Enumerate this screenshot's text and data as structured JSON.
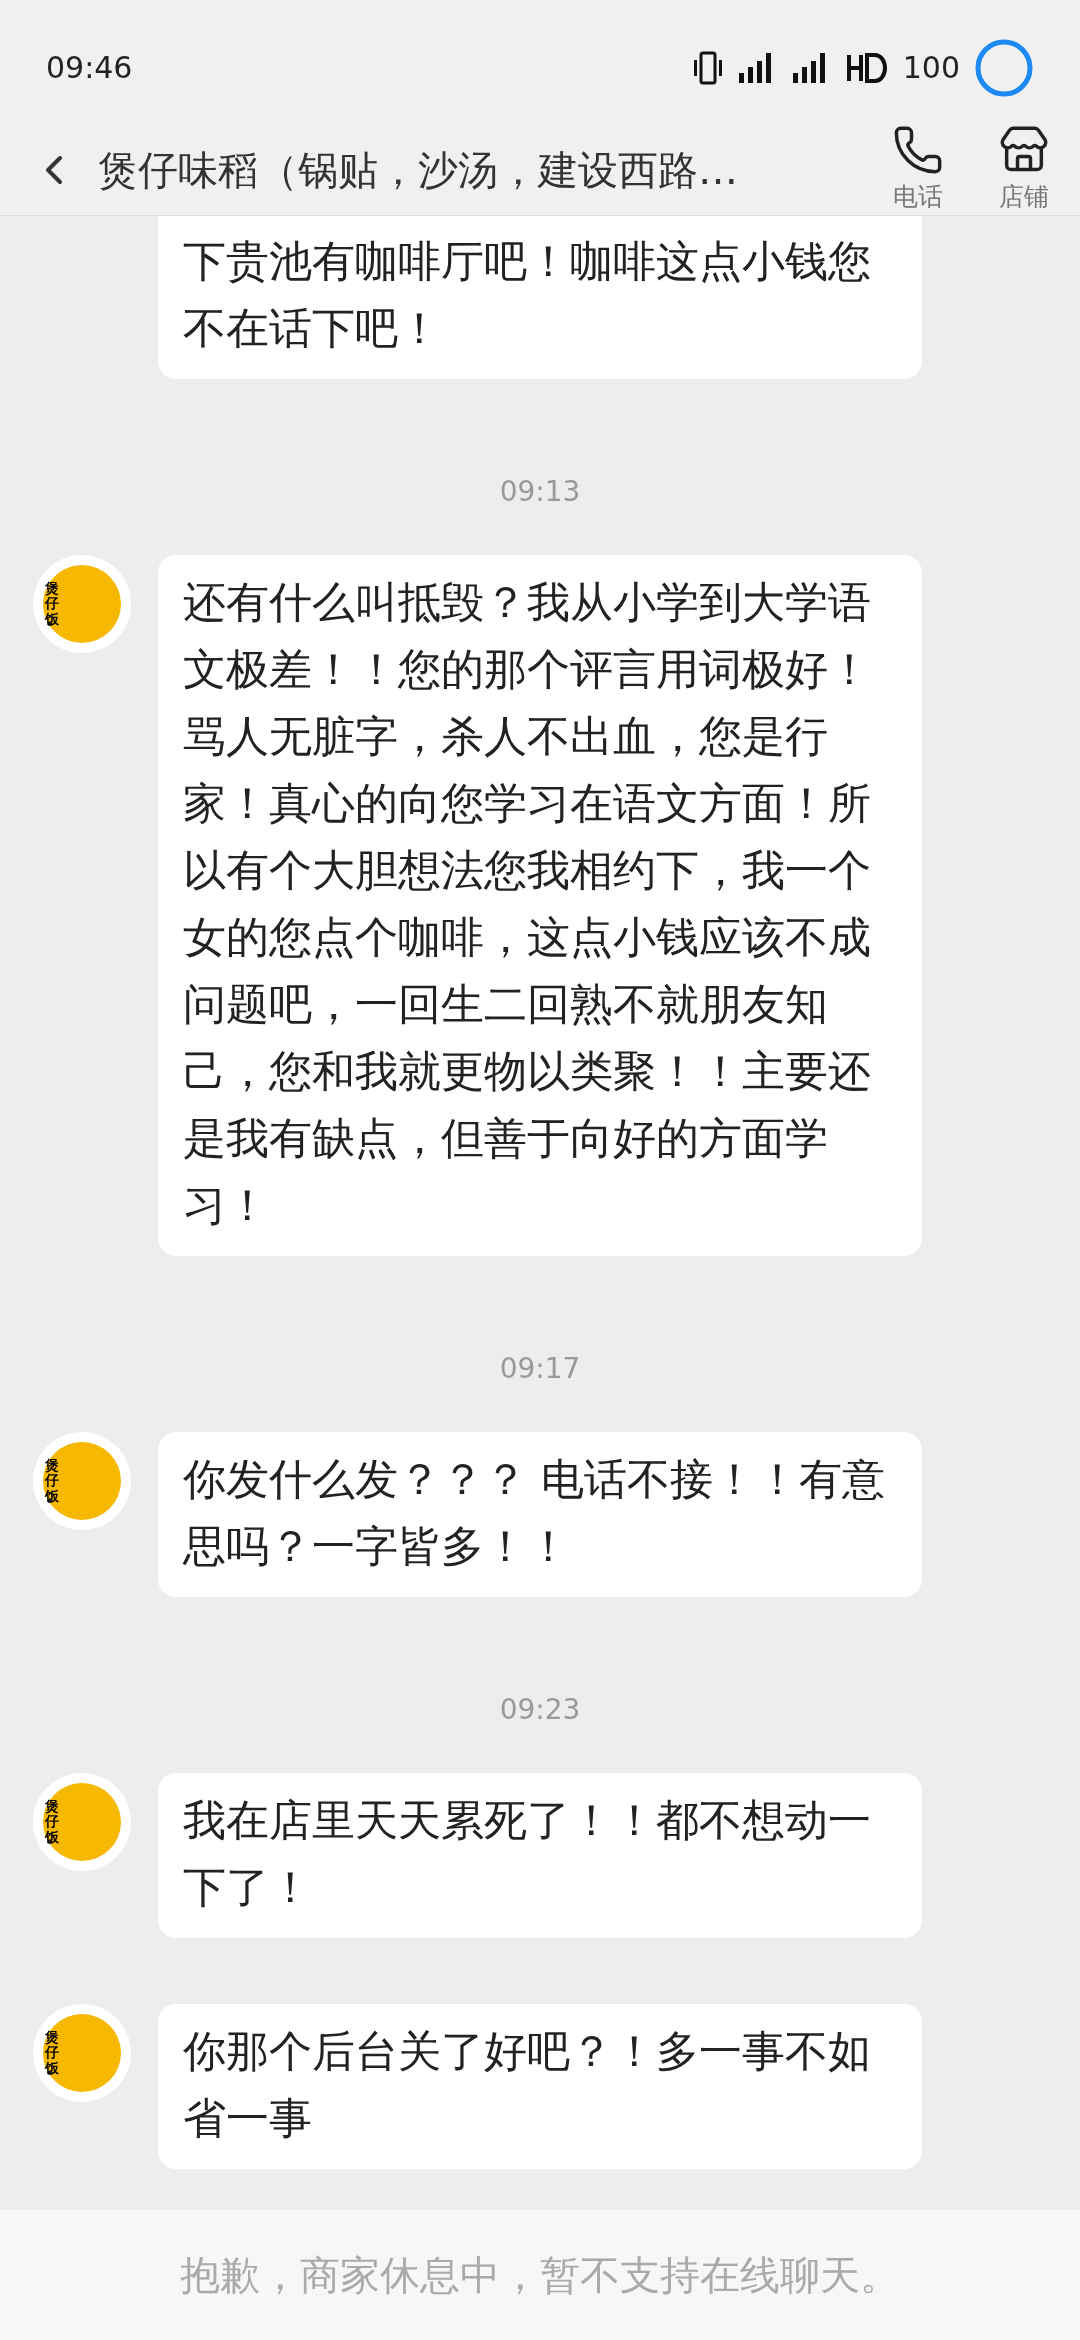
{
  "status_bar": {
    "time": "09:46",
    "battery": "100"
  },
  "header": {
    "title": "煲仔味稻（锅贴，沙汤，建设西路…",
    "actions": [
      {
        "kind": "phone",
        "label": "电话"
      },
      {
        "kind": "store",
        "label": "店铺"
      }
    ]
  },
  "messages": [
    {
      "kind": "bubble",
      "avatar": false,
      "text": "下贵池有咖啡厅吧！咖啡这点小钱您不在话下吧！",
      "cut_top": true
    },
    {
      "kind": "time",
      "text": "09:13"
    },
    {
      "kind": "bubble",
      "avatar": true,
      "avatar_label": "煲仔饭",
      "text": "还有什么叫抵毁？我从小学到大学语文极差！！您的那个评言用词极好！骂人无脏字，杀人不出血，您是行家！真心的向您学习在语文方面！所以有个大胆想法您我相约下，我一个女的您点个咖啡，这点小钱应该不成问题吧，一回生二回熟不就朋友知己，您和我就更物以类聚！！主要还是我有缺点，但善于向好的方面学习！",
      "cut_top": false
    },
    {
      "kind": "time",
      "text": "09:17"
    },
    {
      "kind": "bubble",
      "avatar": true,
      "avatar_label": "煲仔饭",
      "text": "你发什么发？？？ 电话不接！！有意思吗？一字皆多！！",
      "cut_top": false
    },
    {
      "kind": "time",
      "text": "09:23"
    },
    {
      "kind": "bubble",
      "avatar": true,
      "avatar_label": "煲仔饭",
      "text": "我在店里天天累死了！！都不想动一下了！",
      "cut_top": false
    },
    {
      "kind": "bubble",
      "avatar": true,
      "avatar_label": "煲仔饭",
      "text": "你那个后台关了好吧？！多一事不如省一事",
      "cut_top": false
    }
  ],
  "footer": {
    "notice": "抱歉，商家休息中，暂不支持在线聊天。"
  }
}
